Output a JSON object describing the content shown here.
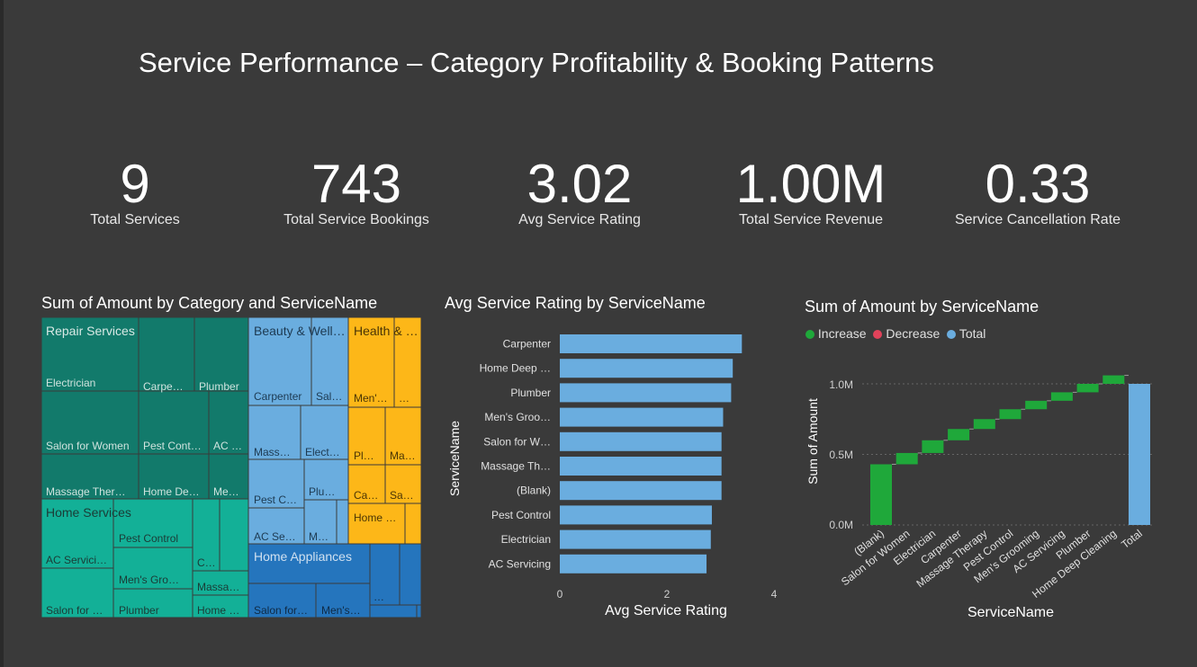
{
  "dashboard": {
    "title": "Service Performance – Category Profitability & Booking Patterns"
  },
  "kpis": [
    {
      "value": "9",
      "label": "Total Services"
    },
    {
      "value": "743",
      "label": "Total Service Bookings"
    },
    {
      "value": "3.02",
      "label": "Avg Service Rating"
    },
    {
      "value": "1.00M",
      "label": "Total Service Revenue"
    },
    {
      "value": "0.33",
      "label": "Service Cancellation Rate"
    }
  ],
  "colors": {
    "background": "#3a3a3a",
    "repair": "#127a6b",
    "home_services": "#13b097",
    "beauty": "#6aaddf",
    "health": "#fdb718",
    "home_appliances": "#2575bd",
    "bar": "#6aaddf",
    "increase": "#1fa83a",
    "decrease": "#e0425a",
    "total": "#6aaddf"
  },
  "treemap": {
    "title": "Sum of Amount by Category and ServiceName",
    "labels": {
      "repair": "Repair Services",
      "home_services": "Home Services",
      "beauty": "Beauty & Well…",
      "health": "Health & …",
      "home_appliances": "Home Appliances",
      "r_electrician": "Electrician",
      "r_carpenter": "Carpe…",
      "r_plumber": "Plumber",
      "r_salon": "Salon for Women",
      "r_pest": "Pest Cont…",
      "r_ac": "AC …",
      "r_massage": "Massage Ther…",
      "r_homedeep": "Home De…",
      "r_mens": "Me…",
      "hs_ac": "AC Servici…",
      "hs_pest": "Pest Control",
      "hs_c": "C…",
      "hs_mens": "Men's Gro…",
      "hs_massage": "Massa…",
      "hs_salon": "Salon for …",
      "hs_plumber": "Plumber",
      "hs_home": "Home …",
      "b_carpenter": "Carpenter",
      "b_sal": "Sal…",
      "b_mass": "Mass…",
      "b_elect": "Elect…",
      "b_pest": "Pest C…",
      "b_plu": "Plu…",
      "b_acse": "AC Se…",
      "b_m": "M…",
      "h_mens": "Men'…",
      "h_dots": "…",
      "h_pl": "Pl…",
      "h_ma": "Ma…",
      "h_ca": "Ca…",
      "h_sa": "Sa…",
      "h_home": "Home …",
      "ha_salon": "Salon for…",
      "ha_mens": "Men's…",
      "ha_dots": "…"
    }
  },
  "bar_chart": {
    "title": "Avg Service Rating by ServiceName",
    "ylabel": "ServiceName",
    "xlabel": "Avg Service Rating",
    "ticks": [
      "0",
      "2",
      "4"
    ]
  },
  "waterfall": {
    "title": "Sum of Amount by ServiceName",
    "legend": [
      {
        "label": "Increase",
        "color": "#1fa83a"
      },
      {
        "label": "Decrease",
        "color": "#e0425a"
      },
      {
        "label": "Total",
        "color": "#6aaddf"
      }
    ],
    "ylabel": "Sum of Amount",
    "xlabel": "ServiceName",
    "yticks": [
      "0.0M",
      "0.5M",
      "1.0M"
    ]
  },
  "chart_data": [
    {
      "type": "bar",
      "title": "Avg Service Rating by ServiceName",
      "orientation": "horizontal",
      "categories": [
        "Carpenter",
        "Home Deep …",
        "Plumber",
        "Men's Groo…",
        "Salon for W…",
        "Massage Th…",
        "(Blank)",
        "Pest Control",
        "Electrician",
        "AC Servicing"
      ],
      "values": [
        3.4,
        3.23,
        3.2,
        3.05,
        3.02,
        3.02,
        3.02,
        2.84,
        2.82,
        2.74
      ],
      "xlabel": "Avg Service Rating",
      "ylabel": "ServiceName",
      "xlim": [
        0,
        4
      ]
    },
    {
      "type": "bar",
      "subtype": "waterfall",
      "title": "Sum of Amount by ServiceName",
      "categories": [
        "(Blank)",
        "Salon for Women",
        "Electrician",
        "Carpenter",
        "Massage Therapy",
        "Pest Control",
        "Men's Grooming",
        "AC Servicing",
        "Plumber",
        "Home Deep Cleaning",
        "Total"
      ],
      "values": [
        0.43,
        0.08,
        0.09,
        0.08,
        0.07,
        0.07,
        0.06,
        0.06,
        0.06,
        0.06,
        1.0
      ],
      "kinds": [
        "increase",
        "increase",
        "increase",
        "increase",
        "increase",
        "increase",
        "increase",
        "increase",
        "increase",
        "increase",
        "total"
      ],
      "xlabel": "ServiceName",
      "ylabel": "Sum of Amount",
      "ylim": [
        0,
        1.1
      ],
      "units": "M"
    }
  ]
}
